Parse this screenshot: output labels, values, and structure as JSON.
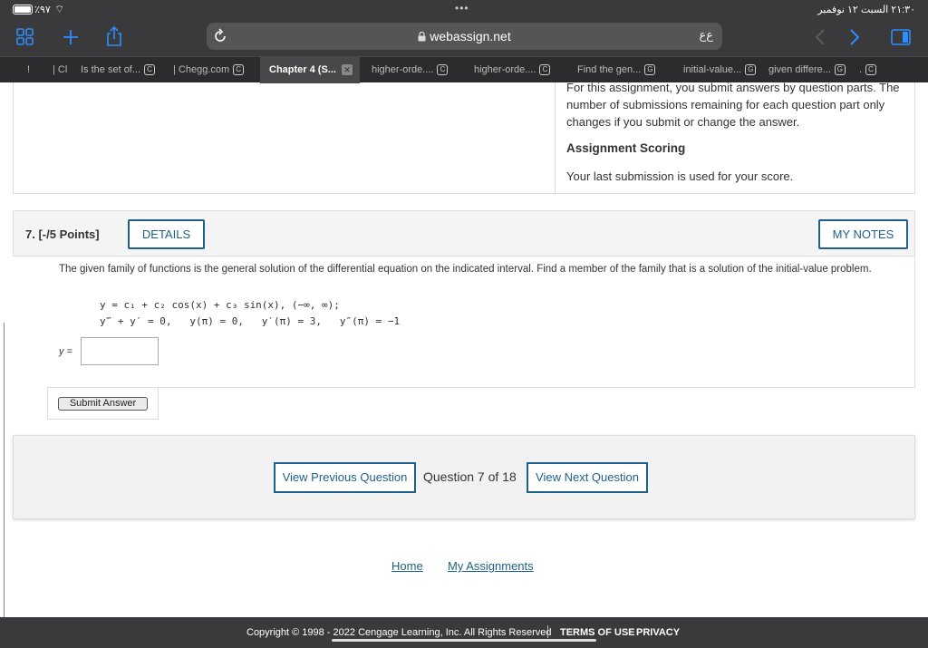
{
  "status_bar": {
    "battery_pct": "٪٩٧",
    "clock": "٢١:٣٠ السبت ١٢ نوفمبر",
    "more_dots": "•••"
  },
  "browser": {
    "url": "webassign.net",
    "extension_label": "ﻉﻉ",
    "icons": {
      "sidebar": "sidebar-icon",
      "new_tab": "plus-icon",
      "share": "share-icon",
      "reload": "reload-icon",
      "lock": "lock-icon",
      "back": "chevron-left-icon",
      "forward": "chevron-right-icon",
      "tabs": "tabs-overview-icon"
    },
    "tabs": [
      {
        "label": "!",
        "favicon": ""
      },
      {
        "label": "| Cl",
        "favicon": ""
      },
      {
        "label": "Is the set of...",
        "favicon": "C"
      },
      {
        "label": "| Chegg.com",
        "favicon": "C"
      },
      {
        "label": "Chapter 4 (S...",
        "favicon": "",
        "active": true
      },
      {
        "label": "higher-orde....",
        "favicon": "C"
      },
      {
        "label": "higher-orde....",
        "favicon": "C"
      },
      {
        "label": "Find the gen...",
        "favicon": "G"
      },
      {
        "label": "initial-value...",
        "favicon": "G"
      },
      {
        "label": "given differe...",
        "favicon": "G"
      },
      {
        "label": ".",
        "favicon": "C"
      }
    ]
  },
  "previous_section": {
    "submission_text": "For this assignment, you submit answers by question parts. The number of submissions remaining for each question part only changes if you submit or change the answer.",
    "scoring_heading": "Assignment Scoring",
    "scoring_text": "Your last submission is used for your score."
  },
  "question": {
    "number_label": "7. [-/5 Points]",
    "details_label": "DETAILS",
    "my_notes_label": "MY NOTES",
    "prompt": "The given family of functions is the general solution of the differential equation on the indicated interval. Find a member of the family that is a solution of the initial-value problem.",
    "family": "y = c₁ + c₂ cos(x) + c₃ sin(x), (−∞, ∞);",
    "ivp": "y‴ + y′ = 0,   y(π) = 0,   y′(π) = 3,   y″(π) = −1",
    "answer_label": "y =",
    "answer_value": "",
    "submit_label": "Submit Answer"
  },
  "navigation": {
    "prev_label": "View Previous Question",
    "counter": "Question 7 of 18",
    "next_label": "View Next Question"
  },
  "footer_links": {
    "home": "Home",
    "assignments": "My Assignments"
  },
  "footer": {
    "copyright": "Copyright © 1998 - 2022 Cengage Learning, Inc. All Rights Reserved",
    "terms": "TERMS OF USE",
    "privacy": "PRIVACY"
  }
}
